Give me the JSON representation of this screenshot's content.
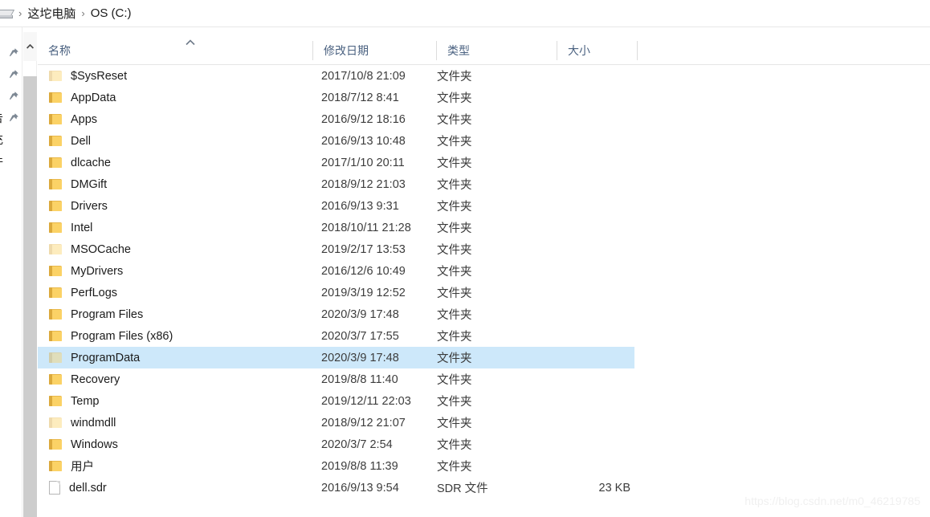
{
  "addressbar": {
    "pc_icon": "computer-icon",
    "separator": "›",
    "crumbs": [
      {
        "label": "这坨电脑"
      },
      {
        "label": "OS (C:)"
      }
    ]
  },
  "left_rail": {
    "items": [
      {
        "label": "",
        "pin": "pin-icon"
      },
      {
        "label": "",
        "pin": "pin-icon"
      },
      {
        "label": "",
        "pin": "pin-icon"
      },
      {
        "label": "告",
        "pin": "pin-icon"
      },
      {
        "label": "充",
        "pin": ""
      },
      {
        "label": "件",
        "pin": ""
      }
    ]
  },
  "scrollbar": {
    "up_arrow_icon": "chevron-up-icon",
    "thumb_position": "middle"
  },
  "columns": {
    "name": "名称",
    "date_modified": "修改日期",
    "type": "类型",
    "size": "大小",
    "sort_column": "名称",
    "sort_direction": "ascending",
    "sort_caret_icon": "caret-up-icon"
  },
  "files": [
    {
      "name": "$SysReset",
      "date": "2017/10/8 21:09",
      "type": "文件夹",
      "size": "",
      "icon": "folder-icon",
      "hidden": true
    },
    {
      "name": "AppData",
      "date": "2018/7/12 8:41",
      "type": "文件夹",
      "size": "",
      "icon": "folder-icon",
      "hidden": false
    },
    {
      "name": "Apps",
      "date": "2016/9/12 18:16",
      "type": "文件夹",
      "size": "",
      "icon": "folder-icon",
      "hidden": false
    },
    {
      "name": "Dell",
      "date": "2016/9/13 10:48",
      "type": "文件夹",
      "size": "",
      "icon": "folder-icon",
      "hidden": false
    },
    {
      "name": "dlcache",
      "date": "2017/1/10 20:11",
      "type": "文件夹",
      "size": "",
      "icon": "folder-icon",
      "hidden": false
    },
    {
      "name": "DMGift",
      "date": "2018/9/12 21:03",
      "type": "文件夹",
      "size": "",
      "icon": "folder-icon",
      "hidden": false
    },
    {
      "name": "Drivers",
      "date": "2016/9/13 9:31",
      "type": "文件夹",
      "size": "",
      "icon": "folder-icon",
      "hidden": false
    },
    {
      "name": "Intel",
      "date": "2018/10/11 21:28",
      "type": "文件夹",
      "size": "",
      "icon": "folder-icon",
      "hidden": false
    },
    {
      "name": "MSOCache",
      "date": "2019/2/17 13:53",
      "type": "文件夹",
      "size": "",
      "icon": "folder-icon",
      "hidden": true
    },
    {
      "name": "MyDrivers",
      "date": "2016/12/6 10:49",
      "type": "文件夹",
      "size": "",
      "icon": "folder-icon",
      "hidden": false
    },
    {
      "name": "PerfLogs",
      "date": "2019/3/19 12:52",
      "type": "文件夹",
      "size": "",
      "icon": "folder-icon",
      "hidden": false
    },
    {
      "name": "Program Files",
      "date": "2020/3/9 17:48",
      "type": "文件夹",
      "size": "",
      "icon": "folder-icon",
      "hidden": false
    },
    {
      "name": "Program Files (x86)",
      "date": "2020/3/7 17:55",
      "type": "文件夹",
      "size": "",
      "icon": "folder-icon",
      "hidden": false
    },
    {
      "name": "ProgramData",
      "date": "2020/3/9 17:48",
      "type": "文件夹",
      "size": "",
      "icon": "folder-icon",
      "hidden": true,
      "selected": true
    },
    {
      "name": "Recovery",
      "date": "2019/8/8 11:40",
      "type": "文件夹",
      "size": "",
      "icon": "folder-icon",
      "hidden": false
    },
    {
      "name": "Temp",
      "date": "2019/12/11 22:03",
      "type": "文件夹",
      "size": "",
      "icon": "folder-icon",
      "hidden": false
    },
    {
      "name": "windmdll",
      "date": "2018/9/12 21:07",
      "type": "文件夹",
      "size": "",
      "icon": "folder-icon",
      "hidden": true
    },
    {
      "name": "Windows",
      "date": "2020/3/7 2:54",
      "type": "文件夹",
      "size": "",
      "icon": "folder-icon",
      "hidden": false
    },
    {
      "name": "用户",
      "date": "2019/8/8 11:39",
      "type": "文件夹",
      "size": "",
      "icon": "folder-icon",
      "hidden": false
    },
    {
      "name": "dell.sdr",
      "date": "2016/9/13 9:54",
      "type": "SDR 文件",
      "size": "23 KB",
      "icon": "file-icon",
      "hidden": false
    }
  ],
  "watermark": "https://blog.csdn.net/m0_46219785",
  "colors": {
    "selection": "#cde8fa",
    "header_text": "#4a6180",
    "folder": "#fbd266",
    "scrollbar_thumb": "#cdcdcd"
  }
}
